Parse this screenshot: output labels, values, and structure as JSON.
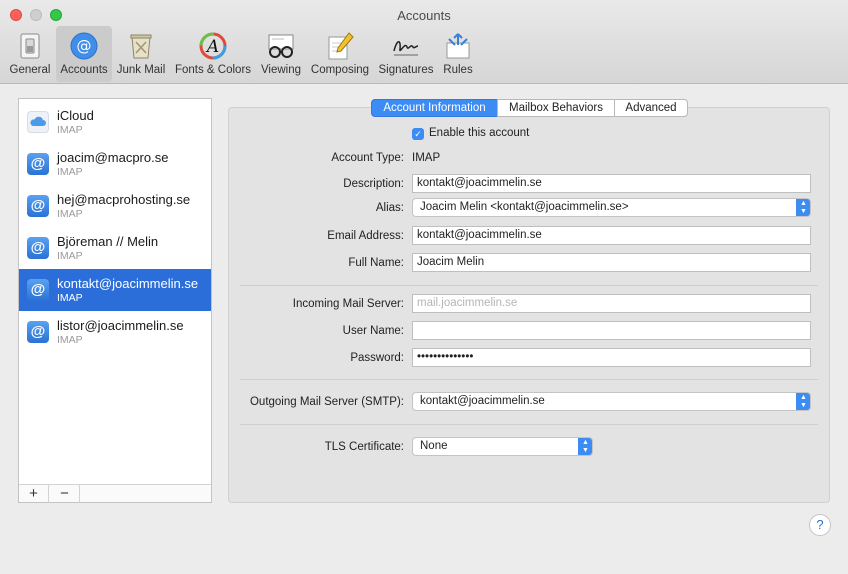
{
  "window": {
    "title": "Accounts"
  },
  "toolbar": {
    "items": [
      {
        "label": "General",
        "icon": "switch-icon"
      },
      {
        "label": "Accounts",
        "icon": "at-icon"
      },
      {
        "label": "Junk Mail",
        "icon": "trash-icon"
      },
      {
        "label": "Fonts & Colors",
        "icon": "font-icon"
      },
      {
        "label": "Viewing",
        "icon": "glasses-icon"
      },
      {
        "label": "Composing",
        "icon": "pencil-icon"
      },
      {
        "label": "Signatures",
        "icon": "signature-icon"
      },
      {
        "label": "Rules",
        "icon": "rules-icon"
      }
    ]
  },
  "accounts": [
    {
      "name": "iCloud",
      "type": "IMAP"
    },
    {
      "name": "joacim@macpro.se",
      "type": "IMAP"
    },
    {
      "name": "hej@macprohosting.se",
      "type": "IMAP"
    },
    {
      "name": "Björeman // Melin",
      "type": "IMAP"
    },
    {
      "name": "kontakt@joacimmelin.se",
      "type": "IMAP"
    },
    {
      "name": "listor@joacimmelin.se",
      "type": "IMAP"
    }
  ],
  "list_buttons": {
    "add": "+",
    "remove": "−"
  },
  "tabs": [
    "Account Information",
    "Mailbox Behaviors",
    "Advanced"
  ],
  "form": {
    "enable_label": "Enable this account",
    "account_type_label": "Account Type:",
    "account_type_value": "IMAP",
    "description_label": "Description:",
    "description_value": "kontakt@joacimmelin.se",
    "alias_label": "Alias:",
    "alias_value": "Joacim Melin <kontakt@joacimmelin.se>",
    "email_label": "Email Address:",
    "email_value": "kontakt@joacimmelin.se",
    "fullname_label": "Full Name:",
    "fullname_value": "Joacim Melin",
    "incoming_label": "Incoming Mail Server:",
    "incoming_placeholder": "mail.joacimmelin.se",
    "username_label": "User Name:",
    "password_label": "Password:",
    "password_value": "••••••••••••••",
    "smtp_label": "Outgoing Mail Server (SMTP):",
    "smtp_value": "kontakt@joacimmelin.se",
    "tls_label": "TLS Certificate:",
    "tls_value": "None"
  },
  "help": {
    "label": "?"
  },
  "colors": {
    "accent": "#3d8cf4",
    "selection": "#2c6ed9"
  }
}
